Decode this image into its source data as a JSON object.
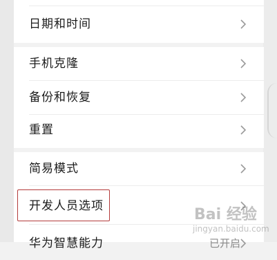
{
  "settings": {
    "group1": {
      "items": [
        {
          "label": "日期和时间"
        }
      ]
    },
    "group2": {
      "items": [
        {
          "label": "手机克隆"
        },
        {
          "label": "备份和恢复"
        },
        {
          "label": "重置"
        }
      ]
    },
    "group3": {
      "items": [
        {
          "label": "简易模式"
        },
        {
          "label": "开发人员选项"
        },
        {
          "label": "华为智慧能力",
          "value": "已开启"
        }
      ]
    }
  },
  "watermark": {
    "text": "Bai 经验",
    "url": "jingyan.baidu.com"
  },
  "colors": {
    "background": "#f2f2f2",
    "card": "#ffffff",
    "highlight": "#b33a3a",
    "chevron": "#9a9a9a"
  }
}
